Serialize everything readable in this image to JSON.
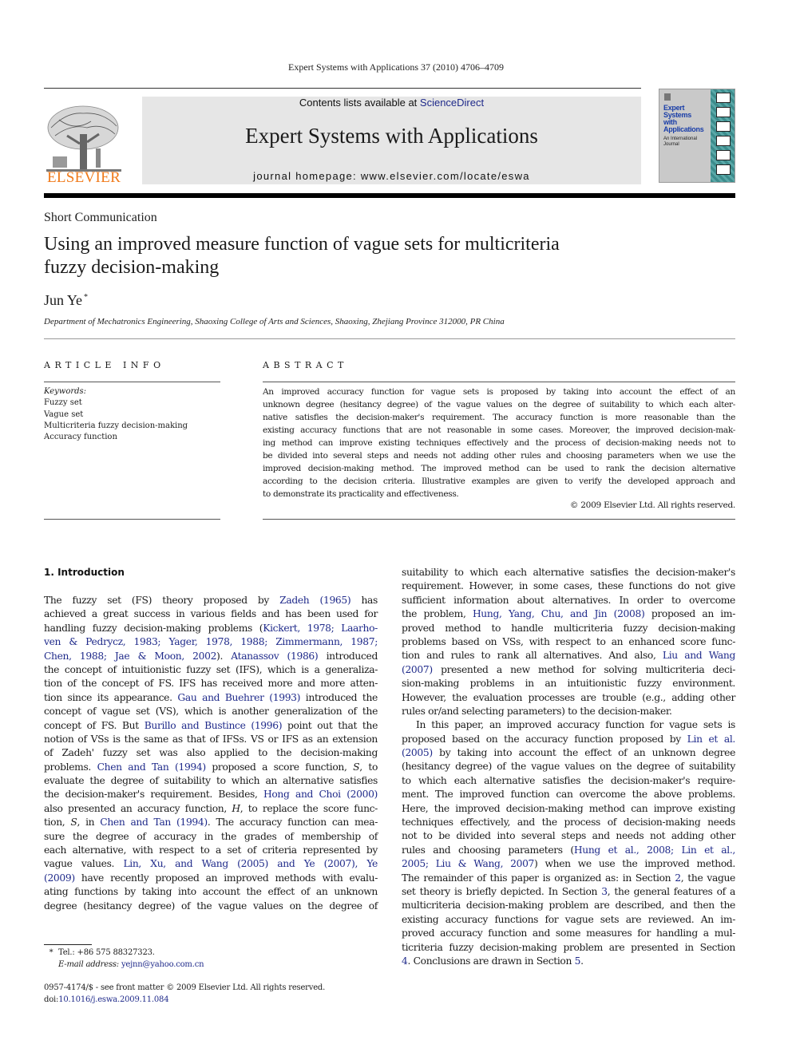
{
  "running_header": "Expert Systems with Applications 37 (2010) 4706–4709",
  "masthead": {
    "contents_prefix": "Contents lists available at ",
    "contents_link": "ScienceDirect",
    "journal_title": "Expert Systems with Applications",
    "homepage": "journal homepage: www.elsevier.com/locate/eswa",
    "publisher_wordmark": "ELSEVIER",
    "publisher_logo_icon": "elsevier-tree-logo",
    "cover": {
      "title_lines": [
        "Expert",
        "Systems",
        "with",
        "Applications"
      ],
      "subtitle_lines": [
        "An International",
        "Journal"
      ]
    }
  },
  "article": {
    "type": "Short Communication",
    "title_lines": [
      "Using an improved measure function of vague sets for multicriteria",
      "fuzzy decision-making"
    ],
    "author": "Jun Ye",
    "author_mark": "*",
    "affiliation": "Department of Mechatronics Engineering, Shaoxing College of Arts and Sciences, Shaoxing, Zhejiang Province 312000, PR China"
  },
  "article_info": {
    "label": "ARTICLE INFO",
    "keywords_label": "Keywords:",
    "keywords": [
      "Fuzzy set",
      "Vague set",
      "Multicriteria fuzzy decision-making",
      "Accuracy function"
    ]
  },
  "abstract": {
    "label": "ABSTRACT",
    "lines": [
      "An improved accuracy function for vague sets is proposed by taking into account the effect of an",
      "unknown degree (hesitancy degree) of the vague values on the degree of suitability to which each alter-",
      "native satisfies the decision-maker's requirement. The accuracy function is more reasonable than the",
      "existing accuracy functions that are not reasonable in some cases. Moreover, the improved decision-mak-",
      "ing method can improve existing techniques effectively and the process of decision-making needs not to",
      "be divided into several steps and needs not adding other rules and choosing parameters when we use the",
      "improved decision-making method. The improved method can be used to rank the decision alternative",
      "according to the decision criteria. Illustrative examples are given to verify the developed approach and",
      "to demonstrate its practicality and effectiveness."
    ],
    "copyright": "© 2009 Elsevier Ltd. All rights reserved."
  },
  "intro": {
    "heading": "1. Introduction",
    "left_lines": [
      [
        {
          "t": "The fuzzy set (FS) theory proposed by "
        },
        {
          "t": "Zadeh (1965)",
          "link": true
        },
        {
          "t": " has"
        }
      ],
      [
        {
          "t": "achieved a great success in various fields and has been used for"
        }
      ],
      [
        {
          "t": "handling fuzzy decision-making problems ("
        },
        {
          "t": "Kickert, 1978; Laarho-",
          "link": true
        }
      ],
      [
        {
          "t": "ven & Pedrycz, 1983; Yager, 1978, 1988; Zimmermann, 1987;",
          "link": true
        }
      ],
      [
        {
          "t": "Chen, 1988; Jae & Moon, 2002",
          "link": true
        },
        {
          "t": "). "
        },
        {
          "t": "Atanassov (1986)",
          "link": true
        },
        {
          "t": " introduced"
        }
      ],
      [
        {
          "t": "the concept of intuitionistic fuzzy set (IFS), which is a generaliza-"
        }
      ],
      [
        {
          "t": "tion of the concept of FS. IFS has received more and more atten-"
        }
      ],
      [
        {
          "t": "tion since its appearance. "
        },
        {
          "t": "Gau and Buehrer (1993)",
          "link": true
        },
        {
          "t": " introduced the"
        }
      ],
      [
        {
          "t": "concept of vague set (VS), which is another generalization of the"
        }
      ],
      [
        {
          "t": "concept of FS. But "
        },
        {
          "t": "Burillo and Bustince (1996)",
          "link": true
        },
        {
          "t": " point out that the"
        }
      ],
      [
        {
          "t": "notion of VSs is the same as that of IFSs. VS or IFS as an extension"
        }
      ],
      [
        {
          "t": "of Zadeh' fuzzy set was also applied to the decision-making"
        }
      ],
      [
        {
          "t": "problems. "
        },
        {
          "t": "Chen and Tan (1994)",
          "link": true
        },
        {
          "t": " proposed a score function, "
        },
        {
          "t": "S",
          "italic": true
        },
        {
          "t": ", to"
        }
      ],
      [
        {
          "t": "evaluate the degree of suitability to which an alternative satisfies"
        }
      ],
      [
        {
          "t": "the decision-maker's requirement. Besides, "
        },
        {
          "t": "Hong and Choi (2000)",
          "link": true
        }
      ],
      [
        {
          "t": "also presented an accuracy function, "
        },
        {
          "t": "H",
          "italic": true
        },
        {
          "t": ", to replace the score func-"
        }
      ],
      [
        {
          "t": "tion, "
        },
        {
          "t": "S",
          "italic": true
        },
        {
          "t": ", in "
        },
        {
          "t": "Chen and Tan (1994)",
          "link": true
        },
        {
          "t": ". The accuracy function can mea-"
        }
      ],
      [
        {
          "t": "sure the degree of accuracy in the grades of membership of"
        }
      ],
      [
        {
          "t": "each alternative, with respect to a set of criteria represented by"
        }
      ],
      [
        {
          "t": "vague values. "
        },
        {
          "t": "Lin, Xu, and Wang (2005) and Ye (2007), Ye",
          "link": true
        }
      ],
      [
        {
          "t": "(2009)",
          "link": true
        },
        {
          "t": " have recently proposed an improved methods with evalu-"
        }
      ],
      [
        {
          "t": "ating functions by taking into account the effect of an unknown"
        }
      ],
      [
        {
          "t": "degree (hesitancy degree) of the vague values on the degree of"
        }
      ]
    ],
    "right_lines": [
      [
        {
          "t": "suitability to which each alternative satisfies the decision-maker's"
        }
      ],
      [
        {
          "t": "requirement. However, in some cases, these functions do not give"
        }
      ],
      [
        {
          "t": "sufficient information about alternatives. In order to overcome"
        }
      ],
      [
        {
          "t": "the problem, "
        },
        {
          "t": "Hung, Yang, Chu, and Jin (2008)",
          "link": true
        },
        {
          "t": " proposed an im-"
        }
      ],
      [
        {
          "t": "proved method to handle multicriteria fuzzy decision-making"
        }
      ],
      [
        {
          "t": "problems based on VSs, with respect to an enhanced score func-"
        }
      ],
      [
        {
          "t": "tion and rules to rank all alternatives. And also, "
        },
        {
          "t": "Liu and Wang",
          "link": true
        }
      ],
      [
        {
          "t": "(2007)",
          "link": true
        },
        {
          "t": " presented a new method for solving multicriteria deci-"
        }
      ],
      [
        {
          "t": "sion-making problems in an intuitionistic fuzzy environment."
        }
      ],
      [
        {
          "t": "However, the evaluation processes are trouble (e.g., adding other"
        }
      ],
      [
        {
          "t": "rules or/and selecting parameters) to the decision-maker.",
          "last": true
        }
      ],
      [
        {
          "t": "In this paper, an improved accuracy function for vague sets is",
          "indent": true
        }
      ],
      [
        {
          "t": "proposed based on the accuracy function proposed by "
        },
        {
          "t": "Lin et al.",
          "link": true
        }
      ],
      [
        {
          "t": "(2005)",
          "link": true
        },
        {
          "t": " by taking into account the effect of an unknown degree"
        }
      ],
      [
        {
          "t": "(hesitancy degree) of the vague values on the degree of suitability"
        }
      ],
      [
        {
          "t": "to which each alternative satisfies the decision-maker's require-"
        }
      ],
      [
        {
          "t": "ment. The improved function can overcome the above problems."
        }
      ],
      [
        {
          "t": "Here, the improved decision-making method can improve existing"
        }
      ],
      [
        {
          "t": "techniques effectively, and the process of decision-making needs"
        }
      ],
      [
        {
          "t": "not to be divided into several steps and needs not adding other"
        }
      ],
      [
        {
          "t": "rules and choosing parameters ("
        },
        {
          "t": "Hung et al., 2008; Lin et al.,",
          "link": true
        }
      ],
      [
        {
          "t": "2005; Liu & Wang, 2007",
          "link": true
        },
        {
          "t": ") when we use the improved method."
        }
      ],
      [
        {
          "t": "The remainder of this paper is organized as: in Section "
        },
        {
          "t": "2",
          "link": true
        },
        {
          "t": ", the vague"
        }
      ],
      [
        {
          "t": "set theory is briefly depicted. In Section "
        },
        {
          "t": "3",
          "link": true
        },
        {
          "t": ", the general features of a"
        }
      ],
      [
        {
          "t": "multicriteria decision-making problem are described, and then the"
        }
      ],
      [
        {
          "t": "existing accuracy functions for vague sets are reviewed. An im-"
        }
      ],
      [
        {
          "t": "proved accuracy function and some measures for handling a mul-"
        }
      ],
      [
        {
          "t": "ticriteria fuzzy decision-making problem are presented in Section"
        }
      ],
      [
        {
          "t": "4",
          "link": true
        },
        {
          "t": ". Conclusions are drawn in Section "
        },
        {
          "t": "5",
          "link": true
        },
        {
          "t": ".",
          "last": true
        }
      ]
    ]
  },
  "footnotes": {
    "star": "*",
    "tel": "Tel.: +86 575 88327323.",
    "email_label": "E-mail address:",
    "email": "yejnn@yahoo.com.cn"
  },
  "front_matter": {
    "issn_line": "0957-4174/$ - see front matter © 2009 Elsevier Ltd. All rights reserved.",
    "doi_prefix": "doi:",
    "doi": "10.1016/j.eswa.2009.11.084"
  },
  "colors": {
    "link": "#1f2a8a",
    "elsevier_orange": "#f07a1a",
    "masthead_gray": "#e6e6e6",
    "cover_teal": "#3c8c8c"
  }
}
